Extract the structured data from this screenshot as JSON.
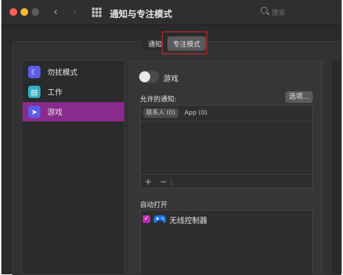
{
  "window": {
    "title": "通知与专注模式",
    "search_placeholder": "搜索"
  },
  "segmented": {
    "items": [
      {
        "label": "通知"
      },
      {
        "label": "专注模式",
        "active": true
      }
    ]
  },
  "sidebar": {
    "items": [
      {
        "label": "勿扰模式",
        "icon": "moon-icon",
        "color": "#5e5ce6"
      },
      {
        "label": "工作",
        "icon": "badge-icon",
        "color": "#30b0c7"
      },
      {
        "label": "游戏",
        "icon": "rocket-icon",
        "color": "#5e5ce6",
        "selected": true
      }
    ]
  },
  "detail": {
    "toggle_label": "游戏",
    "toggle_on": false,
    "allowed_title": "允许的通知:",
    "options_button": "选项...",
    "tabs": [
      {
        "label": "联系人 (0)",
        "active": true
      },
      {
        "label": "App (0)"
      }
    ],
    "add_label": "+",
    "remove_label": "−",
    "auto_title": "自动打开",
    "auto_items": [
      {
        "label": "无线控制器",
        "checked": true,
        "icon": "gamepad-icon"
      }
    ]
  },
  "colors": {
    "accent": "#8a2a8c",
    "highlight_box": "#e02a2a"
  }
}
